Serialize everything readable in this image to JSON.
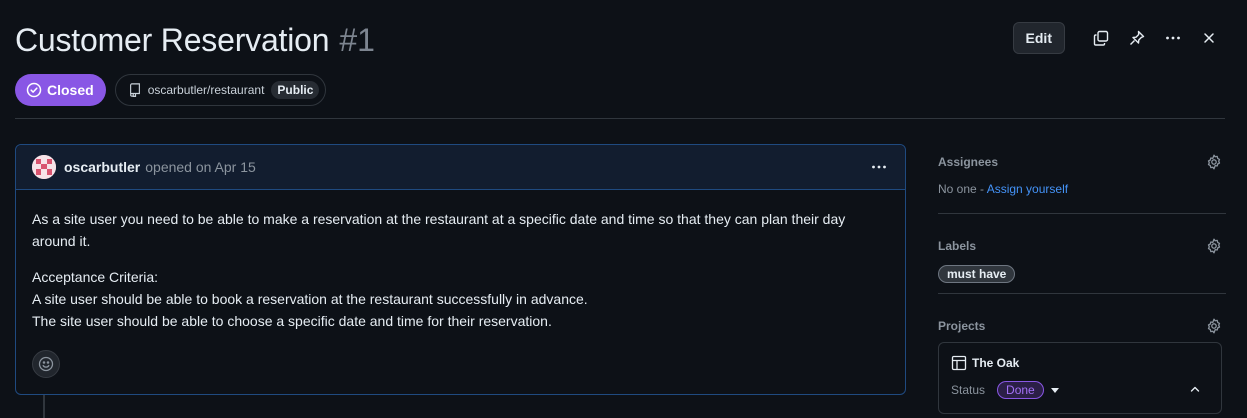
{
  "issue": {
    "title": "Customer Reservation",
    "number": "#1",
    "state": "Closed",
    "repo": "oscarbutler/restaurant",
    "visibility": "Public"
  },
  "toolbar": {
    "edit_label": "Edit",
    "icons": [
      "copy-icon",
      "pin-icon",
      "kebab-icon",
      "close-icon"
    ]
  },
  "comment": {
    "author": "oscarbutler",
    "opened_text": "opened on Apr 15",
    "paragraph1": "As a site user you need to be able to make a reservation at the restaurant at a specific date and time so that they can plan their day around it.",
    "criteria_heading": "Acceptance Criteria:",
    "criteria_line1": "A site user should be able to book a reservation at the restaurant successfully in advance.",
    "criteria_line2": "The site user should be able to choose a specific date and time for their reservation."
  },
  "sidebar": {
    "assignees": {
      "title": "Assignees",
      "none_text": "No one - ",
      "assign_link": "Assign yourself"
    },
    "labels": {
      "title": "Labels",
      "items": [
        "must have"
      ]
    },
    "projects": {
      "title": "Projects",
      "project_name": "The Oak",
      "status_label": "Status",
      "status_value": "Done"
    }
  },
  "colors": {
    "closed_purple": "#8957e5",
    "link_blue": "#4493f8",
    "background": "#0d1117",
    "comment_border": "#1f4a80"
  }
}
